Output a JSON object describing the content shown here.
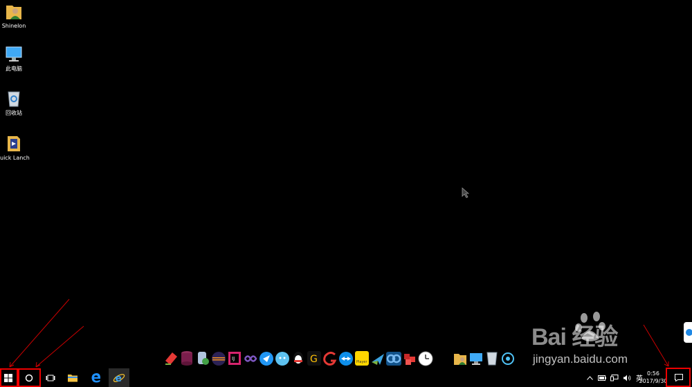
{
  "desktop": {
    "icons": [
      {
        "label": "Shinelon",
        "icon": "user-folder-icon"
      },
      {
        "label": "此电脑",
        "icon": "computer-icon"
      },
      {
        "label": "回收站",
        "icon": "recycle-bin-icon"
      },
      {
        "label": "uick Lanch",
        "icon": "quick-launch-icon"
      }
    ]
  },
  "dock": {
    "items": [
      "eraser-app-icon",
      "database-app-icon",
      "db-tool-icon",
      "eclipse-icon",
      "intellij-icon",
      "infinity-icon",
      "bird-app-icon",
      "cloud-face-icon",
      "qq-penguin-icon",
      "g-app-icon",
      "red-g-app-icon",
      "teamviewer-icon",
      "player-icon",
      "plane-app-icon",
      "baidu-netdisk-icon",
      "red-cube-icon",
      "clock-icon",
      "folder-user-icon",
      "monitor-icon",
      "trash-icon",
      "network-icon"
    ]
  },
  "taskbar": {
    "ime_label": "英",
    "time": "0:56",
    "date": "2017/9/30"
  },
  "watermark": {
    "brand": "Bai 经验",
    "url": "jingyan.baidu.com"
  },
  "colors": {
    "annotation_red": "#e00000",
    "edge_blue": "#1e90ff",
    "folder_yellow": "#e8b64a"
  }
}
